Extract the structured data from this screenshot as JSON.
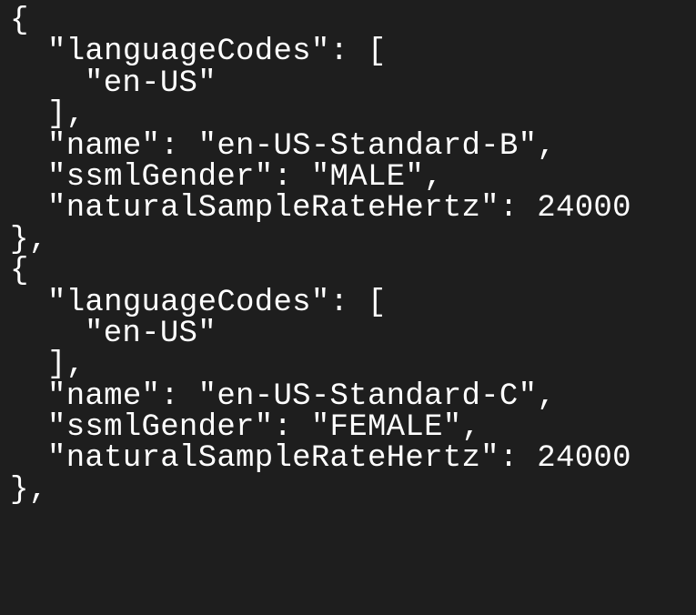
{
  "theme": {
    "background": "#1e1e1e",
    "text": "#ffffff"
  },
  "code": {
    "lines": [
      "{",
      "\"languageCodes\": [",
      "\"en-US\"",
      "],",
      "\"name\": \"en-US-Standard-B\",",
      "\"ssmlGender\": \"MALE\",",
      "\"naturalSampleRateHertz\": 24000",
      "},",
      "{",
      "\"languageCodes\": [",
      "\"en-US\"",
      "],",
      "\"name\": \"en-US-Standard-C\",",
      "\"ssmlGender\": \"FEMALE\",",
      "\"naturalSampleRateHertz\": 24000",
      "},"
    ]
  }
}
